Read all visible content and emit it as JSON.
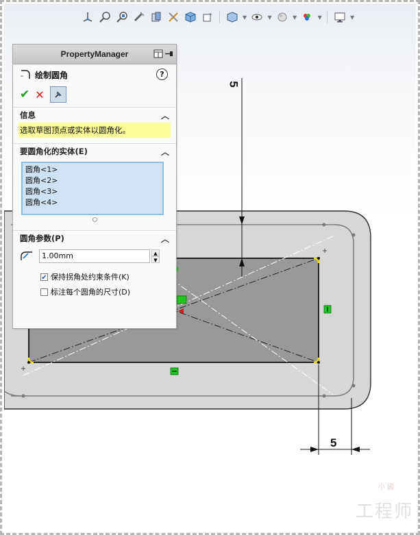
{
  "toolbar": {
    "icons": [
      "view-orientation-icon",
      "zoom-to-fit-icon",
      "zoom-to-area-icon",
      "previous-view-icon",
      "section-view-icon",
      "dynamic-annotation-icon",
      "view-orientation-cube-icon",
      "display-style-icon",
      "hide-show-items-icon",
      "edit-appearance-icon",
      "apply-scene-icon",
      "view-settings-icon"
    ]
  },
  "property_manager": {
    "header": "PropertyManager",
    "title": "绘制圆角",
    "help": "?",
    "sections": {
      "info": {
        "heading": "信息",
        "message": "选取草图顶点或实体以圆角化。"
      },
      "entities": {
        "heading": "要圆角化的实体(E)",
        "items": [
          "圆角<1>",
          "圆角<2>",
          "圆角<3>",
          "圆角<4>"
        ]
      },
      "params": {
        "heading": "圆角参数(P)",
        "radius_value": "1.00mm",
        "keep_constraints_label": "保持拐角处约束条件(K)",
        "keep_constraints_checked": true,
        "dimension_each_label": "标注每个圆角的尺寸(D)",
        "dimension_each_checked": false
      }
    }
  },
  "dimensions": {
    "vertical": "5",
    "horizontal": "5"
  },
  "watermark": {
    "top": "小 國",
    "main": "工程师"
  },
  "colors": {
    "accept": "#1c9b1c",
    "cancel": "#d31a1a",
    "info_highlight": "#fcfc9b",
    "selection_list": "#cfe3f6",
    "relation_marker": "#22c422",
    "fillet_highlight": "#f0e000"
  }
}
